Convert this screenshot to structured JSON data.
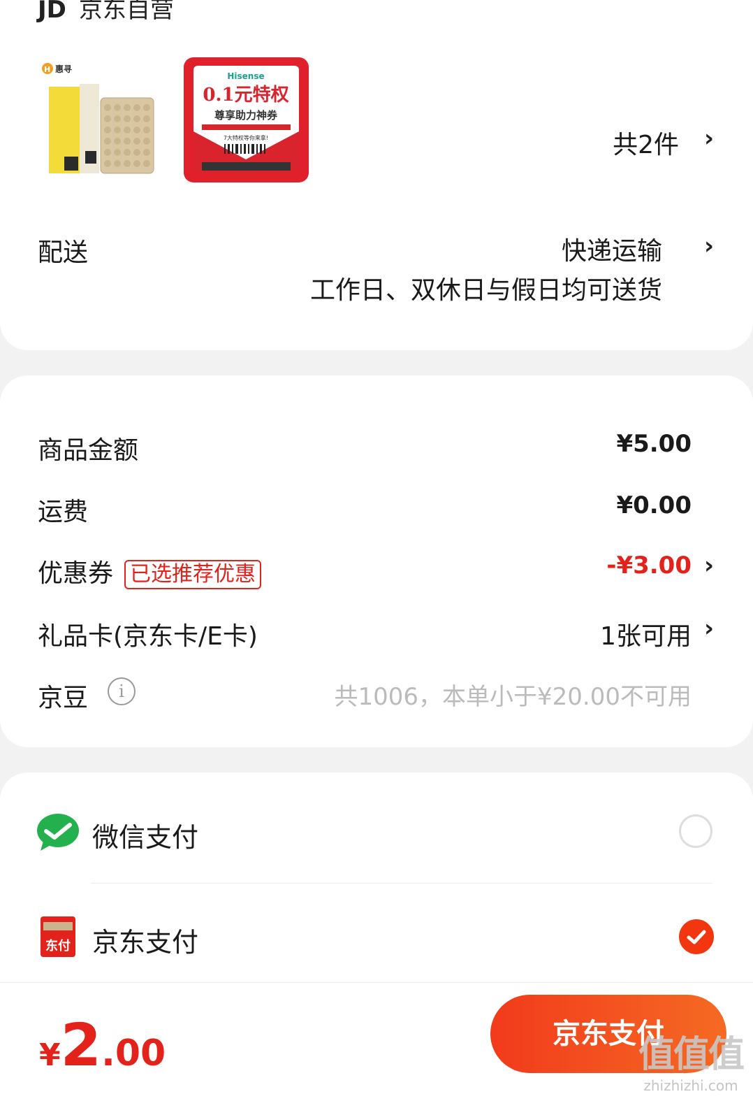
{
  "shop": {
    "logo": "JD",
    "name": "京东自营"
  },
  "products": {
    "thumb1_brand": "惠寻",
    "thumb2_brand": "Hisense",
    "thumb2_title": "0.1元特权",
    "thumb2_subtitle": "尊享助力神券",
    "thumb2_note": "7大特权等你来拿!",
    "count": "共2件"
  },
  "delivery": {
    "label": "配送",
    "method": "快递运输",
    "note": "工作日、双休日与假日均可送货"
  },
  "summary": {
    "goods_label": "商品金额",
    "goods_value": "¥5.00",
    "shipping_label": "运费",
    "shipping_value": "¥0.00",
    "coupon_label": "优惠券",
    "coupon_tag": "已选推荐优惠",
    "coupon_value": "-¥3.00",
    "giftcard_label": "礼品卡(京东卡/E卡)",
    "giftcard_value": "1张可用",
    "beans_label": "京豆",
    "beans_value": "共1006，本单小于¥20.00不可用"
  },
  "payment": {
    "wechat_label": "微信支付",
    "jd_label": "京东支付",
    "jd_icon_text": "东付"
  },
  "bottom": {
    "total_symbol": "¥",
    "total_int": "2",
    "total_dec": ".00",
    "pay_button": "京东支付",
    "watermark": "值值值",
    "watermark_url": "zhizhizhi.com"
  },
  "colors": {
    "accent": "#e3231b",
    "wechat": "#22b14c",
    "disabled": "#bbbbbb"
  }
}
